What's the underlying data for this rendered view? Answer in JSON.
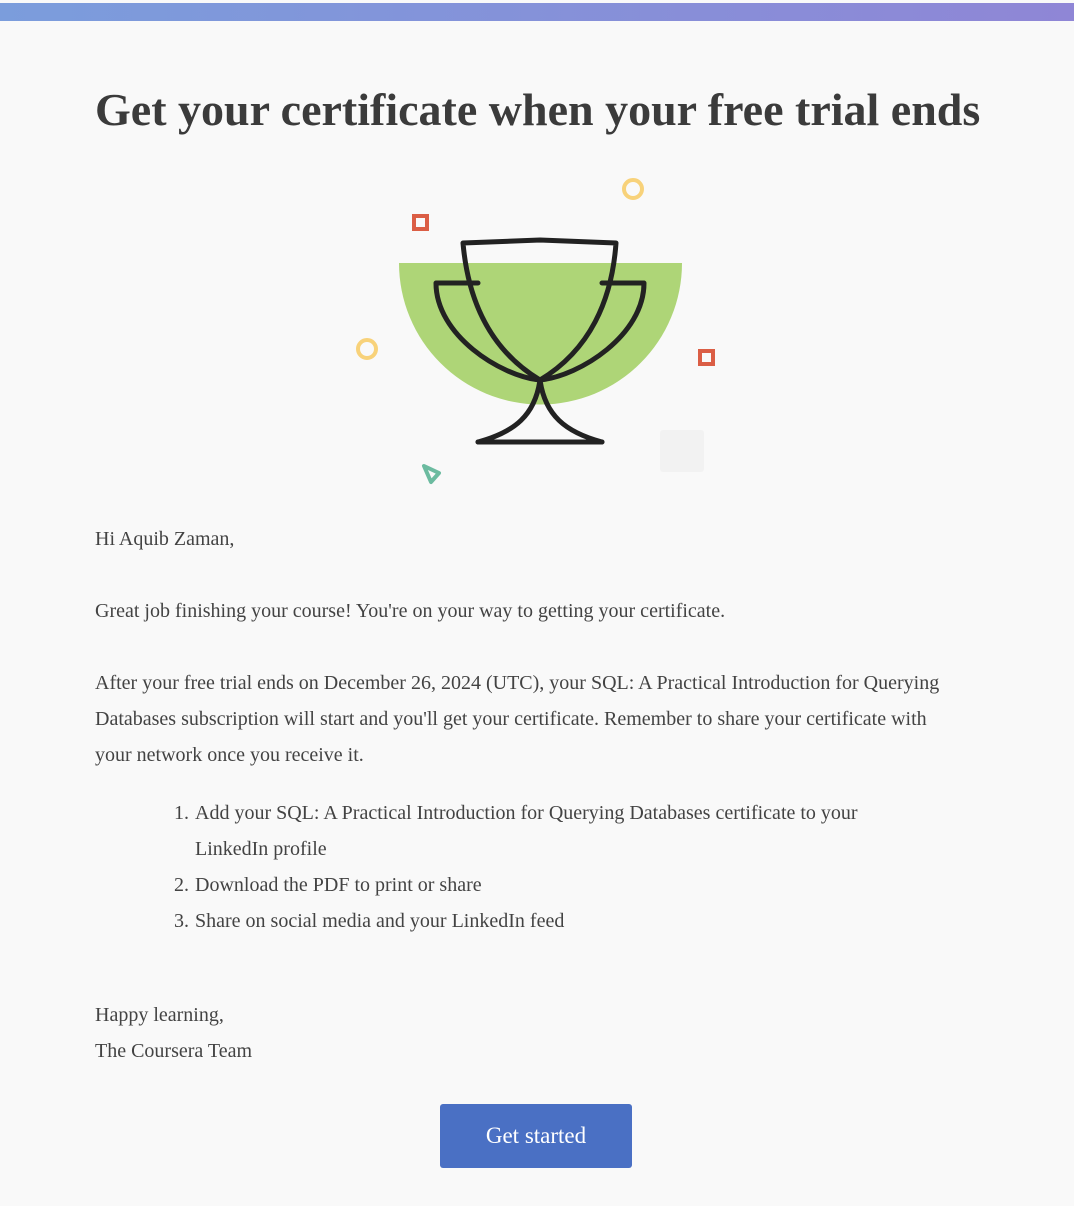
{
  "email": {
    "title": "Get your certificate when your free trial ends",
    "greeting": "Hi Aquib Zaman,",
    "intro": "Great job finishing your course! You're on your way to getting your certificate.",
    "details": "After your free trial ends on December 26, 2024 (UTC), your SQL: A Practical Introduction for Querying Databases subscription will start and you'll get your certificate. Remember to share your certificate with your network once you receive it.",
    "steps": [
      "Add your SQL: A Practical Introduction for Querying Databases certificate to your LinkedIn profile",
      "Download the PDF to print or share",
      "Share on social media and your LinkedIn feed"
    ],
    "signoff": "Happy learning,",
    "signature": "The Coursera Team",
    "cta_label": "Get started"
  },
  "illustration": {
    "icon": "trophy-icon",
    "colors": {
      "bowl": "#aed577",
      "outline": "#222222",
      "circle": "#f8d27a",
      "square": "#db5e45",
      "triangle": "#6cbba0"
    }
  },
  "colors": {
    "top_bar_start": "#7b9ddc",
    "top_bar_end": "#8f86d6",
    "button": "#4a70c4",
    "text": "#434343",
    "title": "#3b3b3b"
  }
}
